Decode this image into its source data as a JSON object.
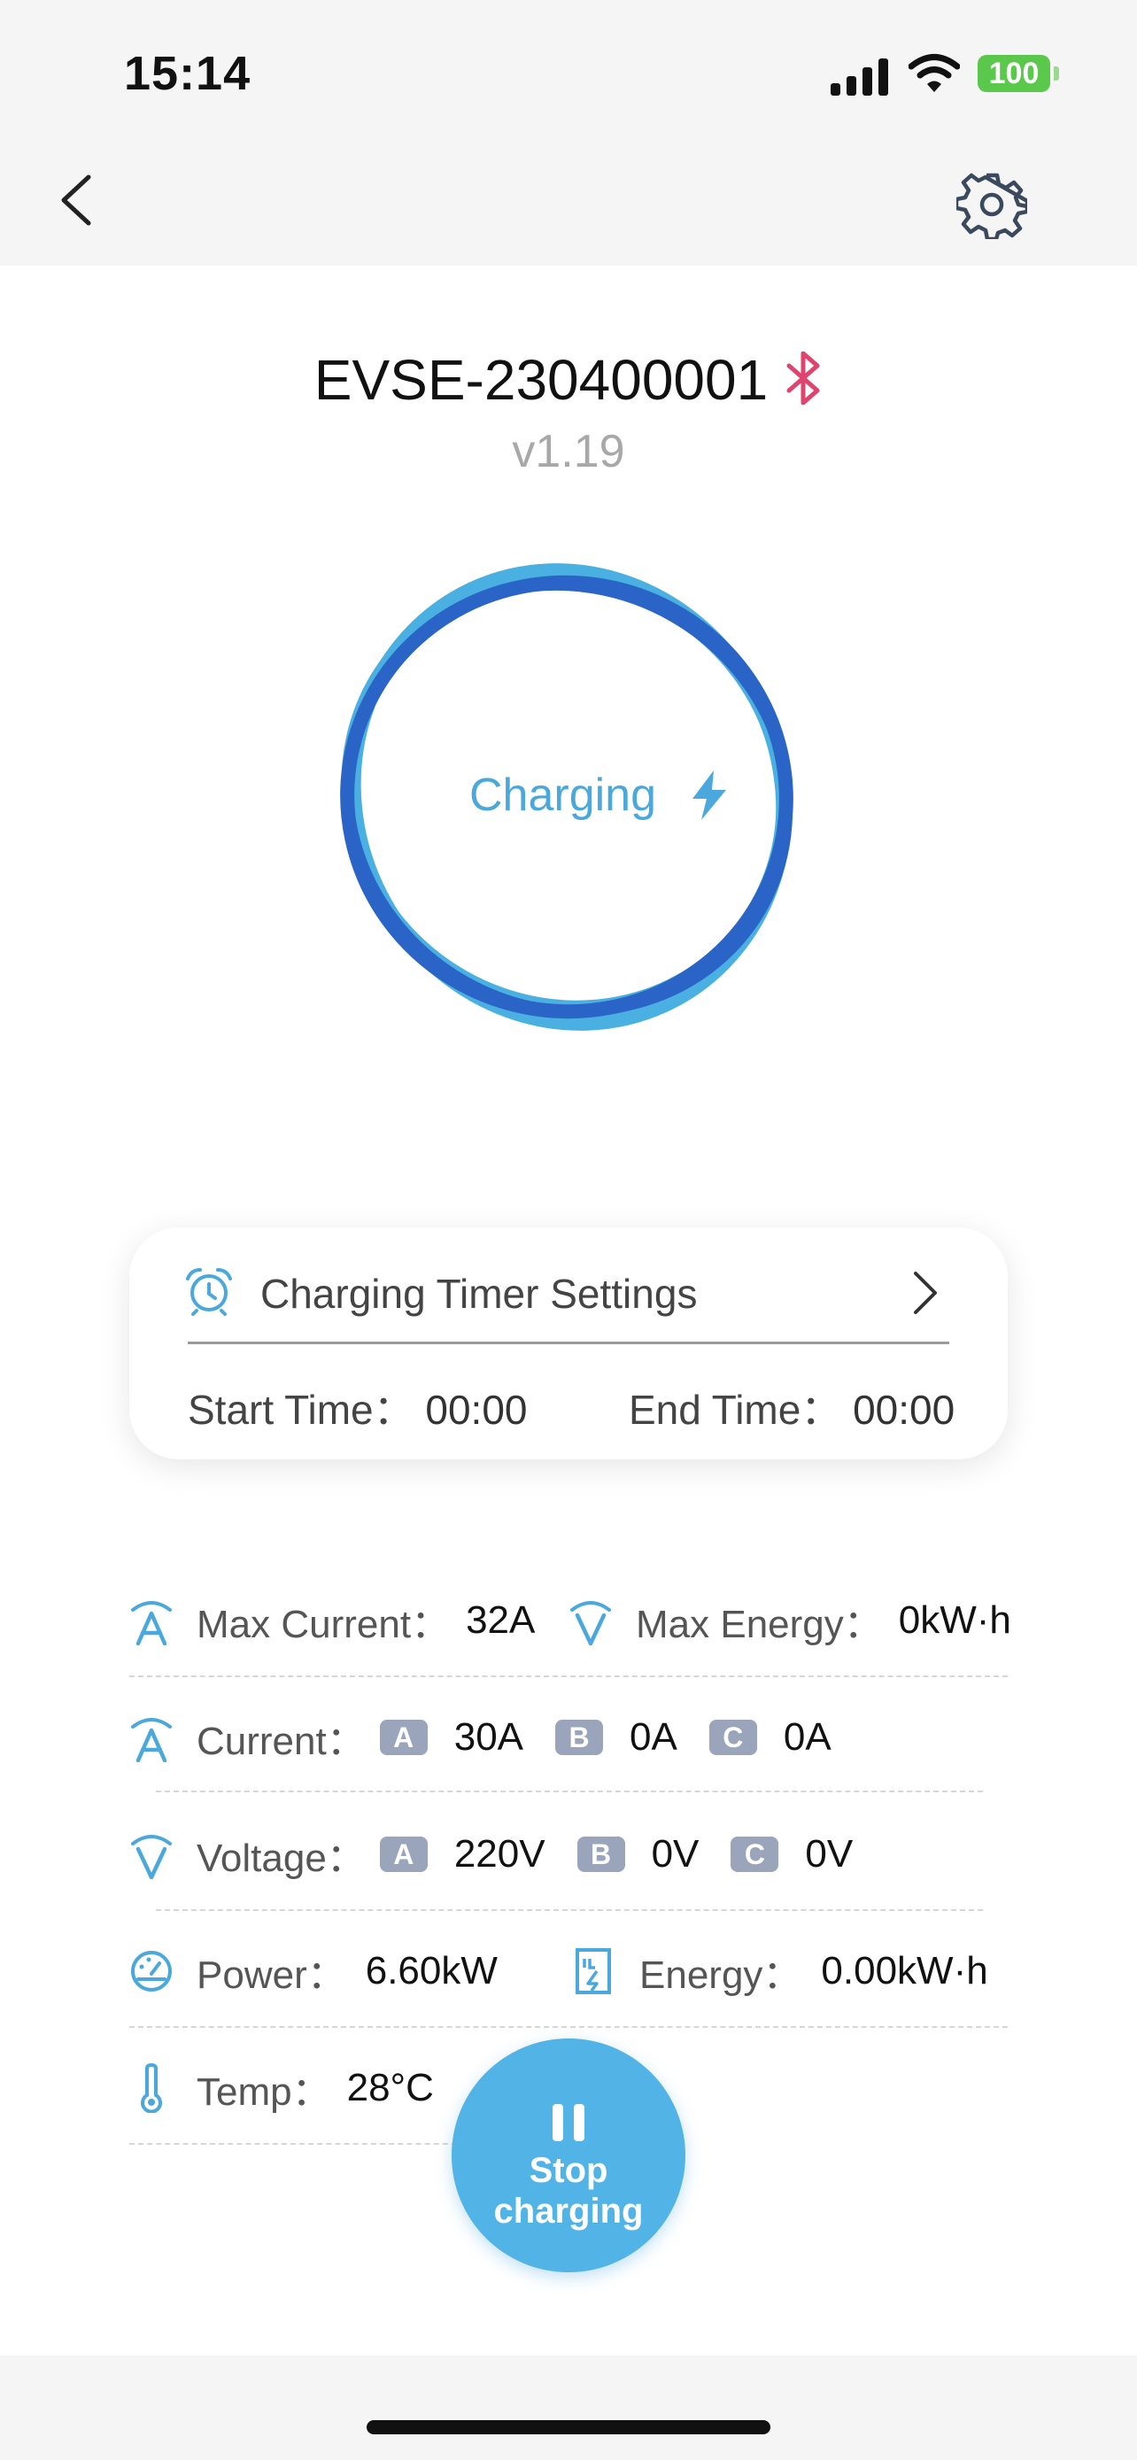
{
  "status_bar": {
    "time": "15:14",
    "battery": "100"
  },
  "device": {
    "name": "EVSE-230400001",
    "version": "v1.19"
  },
  "charging": {
    "status": "Charging"
  },
  "timer": {
    "title": "Charging Timer Settings",
    "start_label": "Start Time：",
    "start_value": "00:00",
    "end_label": "End Time：",
    "end_value": "00:00"
  },
  "metrics": {
    "max_current_label": "Max Current：",
    "max_current_value": "32A",
    "max_energy_label": "Max Energy：",
    "max_energy_value": "0kW·h",
    "current_label": "Current：",
    "current": {
      "a": "30A",
      "b": "0A",
      "c": "0A"
    },
    "voltage_label": "Voltage：",
    "voltage": {
      "a": "220V",
      "b": "0V",
      "c": "0V"
    },
    "phase_labels": {
      "a": "A",
      "b": "B",
      "c": "C"
    },
    "power_label": "Power：",
    "power_value": "6.60kW",
    "energy_label": "Energy：",
    "energy_value": "0.00kW·h",
    "temp_label": "Temp：",
    "temp_value": "28°C"
  },
  "stop_button": {
    "line1": "Stop",
    "line2": "charging"
  },
  "colors": {
    "accent": "#4ba8dc",
    "ring_dark": "#2b64c7",
    "ring_light": "#4ab0e2",
    "bluetooth": "#e0446e",
    "battery": "#5ac84b",
    "badge": "#9aa4ba",
    "button": "#51b3e6"
  },
  "icons": {
    "back": "chevron-left-icon",
    "settings": "gear-icon",
    "bluetooth": "bluetooth-icon",
    "bolt": "lightning-bolt-icon",
    "alarm": "alarm-clock-icon",
    "current": "ampere-icon",
    "voltage": "voltage-icon",
    "power": "gauge-icon",
    "energy": "energy-meter-icon",
    "temp": "thermometer-icon",
    "pause": "pause-icon"
  }
}
